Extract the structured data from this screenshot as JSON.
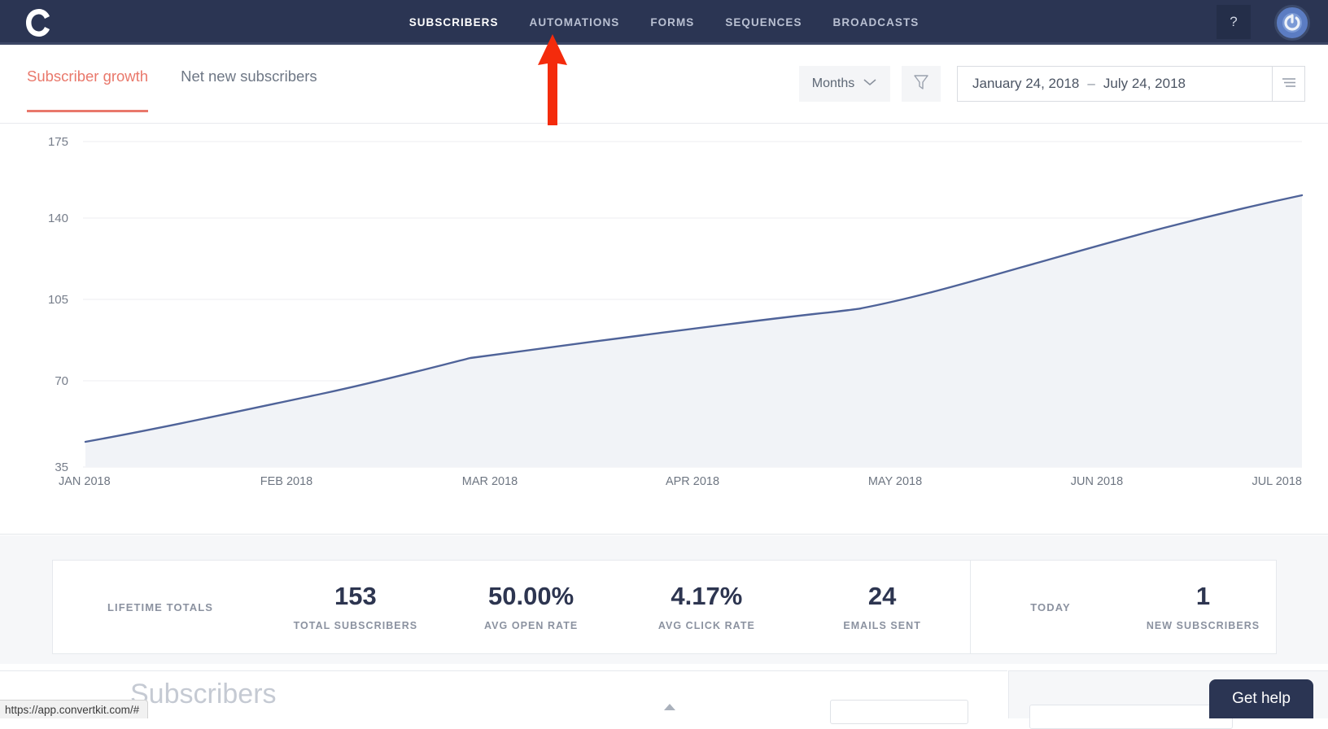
{
  "topnav": {
    "logo_icon": "convertkit-logo-icon",
    "links": [
      {
        "label": "SUBSCRIBERS",
        "active": true
      },
      {
        "label": "AUTOMATIONS",
        "active": false
      },
      {
        "label": "FORMS",
        "active": false
      },
      {
        "label": "SEQUENCES",
        "active": false
      },
      {
        "label": "BROADCASTS",
        "active": false
      }
    ],
    "help_label": "?",
    "avatar_icon": "user-avatar-icon",
    "background_color": "#2b3553"
  },
  "annotation": {
    "arrow_color": "#f42b0c",
    "points_to": "AUTOMATIONS"
  },
  "toolbar": {
    "tabs": [
      {
        "label": "Subscriber growth",
        "active": true
      },
      {
        "label": "Net new subscribers",
        "active": false
      }
    ],
    "granularity": {
      "value": "Months",
      "chevron_icon": "chevron-down-icon"
    },
    "filter_icon": "filter-funnel-icon",
    "date_range": {
      "start": "January 24, 2018",
      "separator": "–",
      "end": "July 24, 2018"
    },
    "list_icon": "list-lines-icon",
    "accent_color": "#e9786b"
  },
  "chart_data": {
    "type": "area",
    "title": "Subscriber growth",
    "xlabel": "",
    "ylabel": "",
    "grid": true,
    "legend": "none",
    "line_color": "#4f6399",
    "fill_color": "#f1f3f7",
    "ylim": [
      35,
      175
    ],
    "yticks": [
      175,
      140,
      105,
      70,
      35
    ],
    "categories": [
      "JAN 2018",
      "FEB 2018",
      "MAR 2018",
      "APR 2018",
      "MAY 2018",
      "JUN 2018",
      "JUL 2018"
    ],
    "x": [
      "JAN 2018",
      "FEB 2018",
      "MAR 2018",
      "APR 2018",
      "MAY 2018",
      "JUN 2018",
      "JUL 2018"
    ],
    "values": [
      46,
      70,
      88,
      95,
      106,
      125,
      152
    ],
    "series": [
      {
        "name": "Subscribers",
        "values": [
          46,
          70,
          88,
          95,
          106,
          125,
          152
        ]
      }
    ]
  },
  "stats": {
    "lifetime_label": "LIFETIME TOTALS",
    "lifetime_metrics": [
      {
        "value": "153",
        "caption": "TOTAL SUBSCRIBERS"
      },
      {
        "value": "50.00%",
        "caption": "AVG OPEN RATE"
      },
      {
        "value": "4.17%",
        "caption": "AVG CLICK RATE"
      },
      {
        "value": "24",
        "caption": "EMAILS SENT"
      }
    ],
    "today_label": "TODAY",
    "today_metrics": [
      {
        "value": "1",
        "caption": "NEW SUBSCRIBERS"
      }
    ]
  },
  "lower": {
    "heading": "Subscribers",
    "caret_icon": "caret-up-icon"
  },
  "statusbar": {
    "url": "https://app.convertkit.com/#"
  },
  "gethelp": {
    "label": "Get help"
  }
}
